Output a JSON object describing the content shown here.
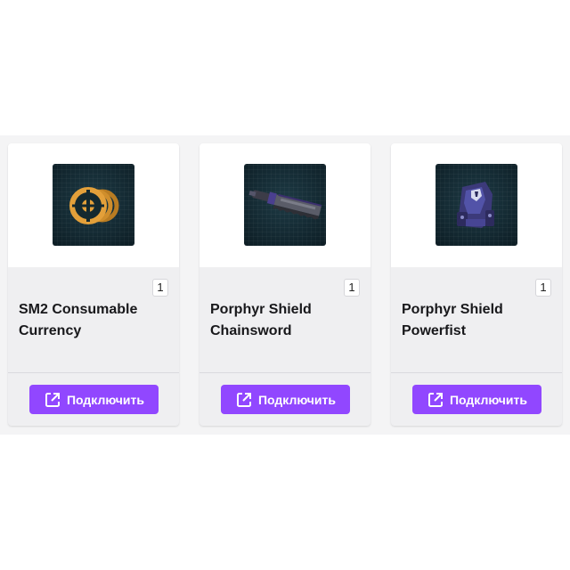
{
  "accent_color": "#9147ff",
  "cards": [
    {
      "name_line1": "SM2 Consumable",
      "name_line2": "Currency",
      "quantity": "1",
      "image_icon": "coin-stack-icon",
      "button_label": "Подключить",
      "button_icon": "external-link-icon"
    },
    {
      "name_line1": "Porphyr Shield",
      "name_line2": "Chainsword",
      "quantity": "1",
      "image_icon": "chainsword-icon",
      "button_label": "Подключить",
      "button_icon": "external-link-icon"
    },
    {
      "name_line1": "Porphyr Shield",
      "name_line2": "Powerfist",
      "quantity": "1",
      "image_icon": "powerfist-icon",
      "button_label": "Подключить",
      "button_icon": "external-link-icon"
    }
  ]
}
